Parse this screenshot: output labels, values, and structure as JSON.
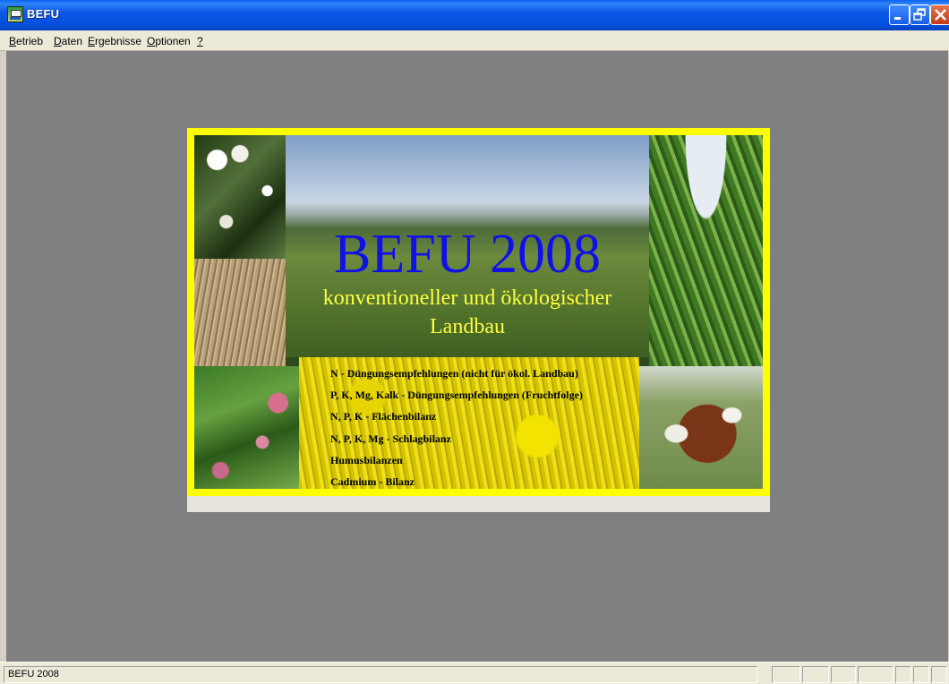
{
  "window": {
    "title": "BEFU"
  },
  "menu": [
    {
      "label": "Betrieb",
      "mnemonic": "B"
    },
    {
      "label": "Daten",
      "mnemonic": "D"
    },
    {
      "label": "Ergebnisse",
      "mnemonic": "E"
    },
    {
      "label": "Optionen",
      "mnemonic": "O"
    },
    {
      "label": "?",
      "mnemonic": "?"
    }
  ],
  "splash": {
    "title": "BEFU 2008",
    "subtitle_line1": "konventioneller und ökologischer",
    "subtitle_line2": "Landbau",
    "features": [
      "N - Düngungsempfehlungen (nicht für ökol. Landbau)",
      "P, K, Mg, Kalk - Düngungsempfehlungen (Fruchtfolge)",
      "N, P, K - Flächenbilanz",
      "N, P, K, Mg - Schlagbilanz",
      "Humusbilanzen",
      "Cadmium - Bilanz"
    ],
    "photos": [
      "flowering-shrub",
      "grain",
      "clover",
      "field-landscape",
      "rapeseed-field",
      "corn",
      "cattle"
    ]
  },
  "statusbar": {
    "text": "BEFU 2008",
    "panels": [
      "",
      "",
      "",
      "",
      "",
      "",
      ""
    ]
  },
  "colors": {
    "titlebar": "#0a58e8",
    "frame": "#ffff00",
    "title_text": "#1010e8",
    "subtitle_text": "#ffff40",
    "client_bg": "#808080"
  }
}
